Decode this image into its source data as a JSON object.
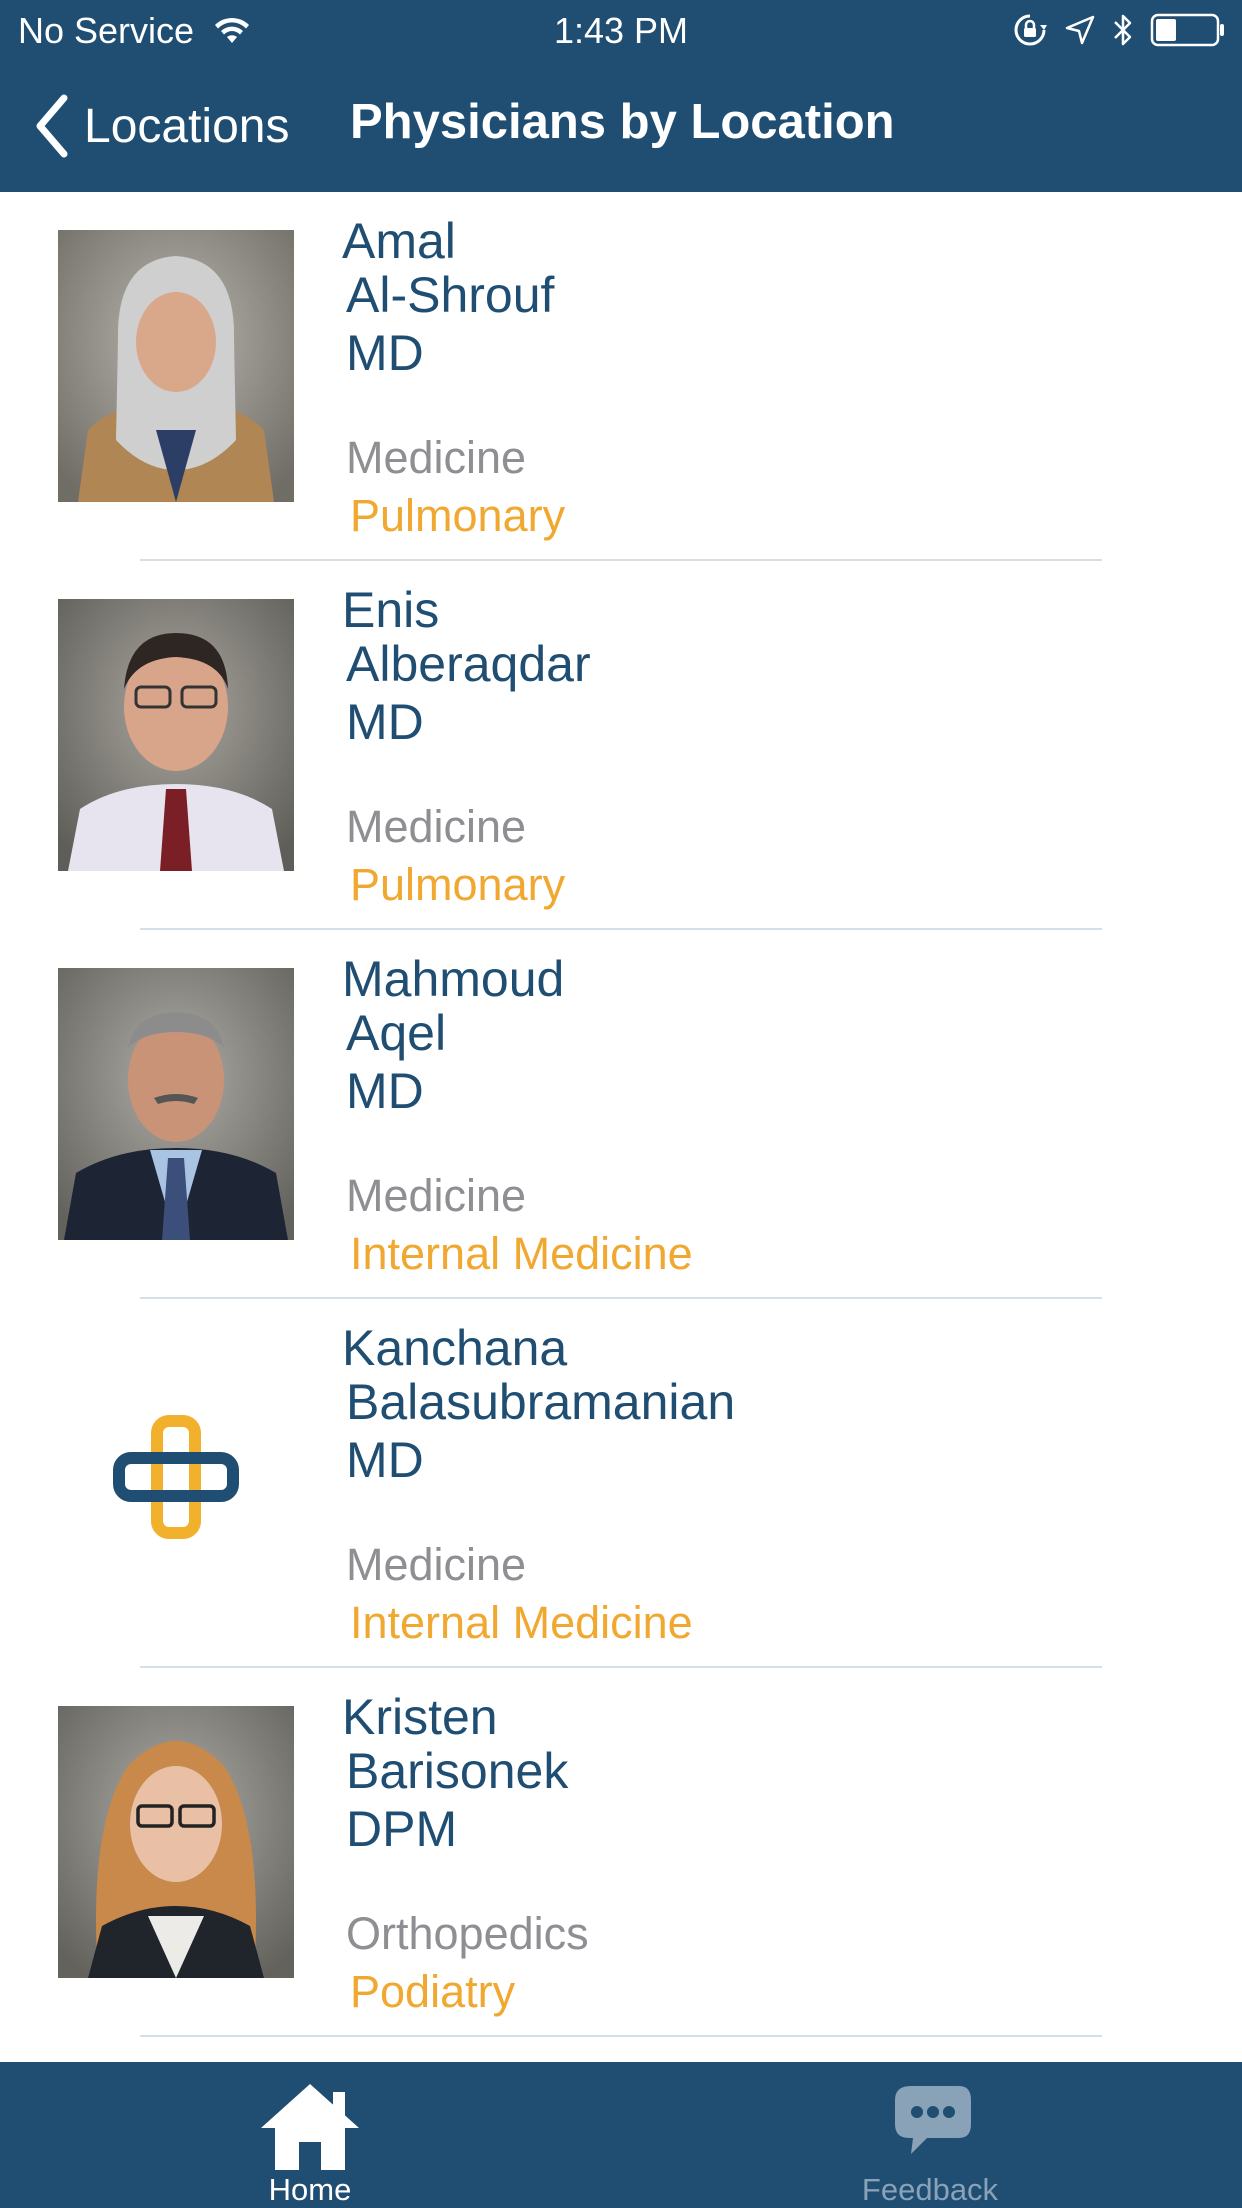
{
  "status_bar": {
    "carrier": "No Service",
    "time": "1:43 PM"
  },
  "nav": {
    "back_label": "Locations",
    "title": "Physicians by Location"
  },
  "colors": {
    "bar": "#1f4e72",
    "name": "#1f4e72",
    "department": "#8e8e93",
    "specialty": "#f0a830"
  },
  "physicians": [
    {
      "first": "Amal",
      "last": "Al-Shrouf",
      "credential": "MD",
      "department": "Medicine",
      "specialty": "Pulmonary"
    },
    {
      "first": "Enis",
      "last": "Alberaqdar",
      "credential": "MD",
      "department": "Medicine",
      "specialty": "Pulmonary"
    },
    {
      "first": "Mahmoud",
      "last": "Aqel",
      "credential": "MD",
      "department": "Medicine",
      "specialty": "Internal Medicine"
    },
    {
      "first": "Kanchana",
      "last": "Balasubramanian",
      "credential": "MD",
      "department": "Medicine",
      "specialty": "Internal Medicine"
    },
    {
      "first": "Kristen",
      "last": "Barisonek",
      "credential": "DPM",
      "department": "Orthopedics",
      "specialty": "Podiatry"
    }
  ],
  "tabs": {
    "home": "Home",
    "feedback": "Feedback"
  }
}
